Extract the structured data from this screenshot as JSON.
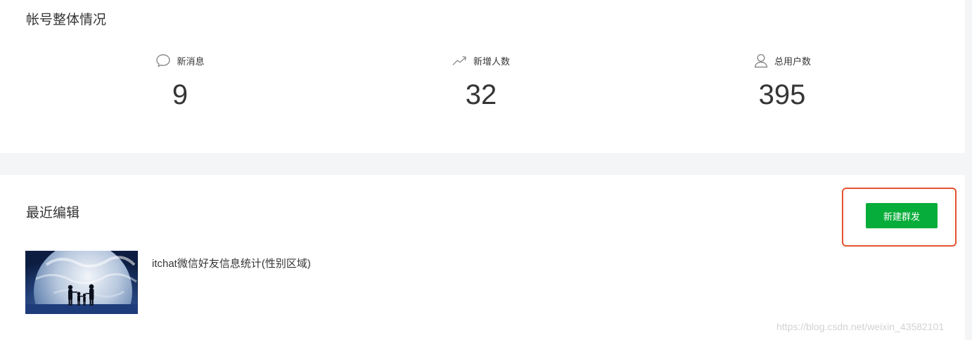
{
  "overview": {
    "title": "帐号整体情况",
    "stats": [
      {
        "label": "新消息",
        "value": "9",
        "icon": "chat-bubble-icon"
      },
      {
        "label": "新增人数",
        "value": "32",
        "icon": "trend-up-icon"
      },
      {
        "label": "总用户数",
        "value": "395",
        "icon": "user-icon"
      }
    ]
  },
  "recent": {
    "title": "最近编辑",
    "new_button_label": "新建群发",
    "article": {
      "title": "itchat微信好友信息统计(性别区域)",
      "thumbnail": "earth-family-silhouette-image"
    }
  },
  "colors": {
    "accent_green": "#07ad3a",
    "highlight_red": "#e5532f",
    "background": "#f4f5f6"
  },
  "watermark": "https://blog.csdn.net/weixin_43582101"
}
